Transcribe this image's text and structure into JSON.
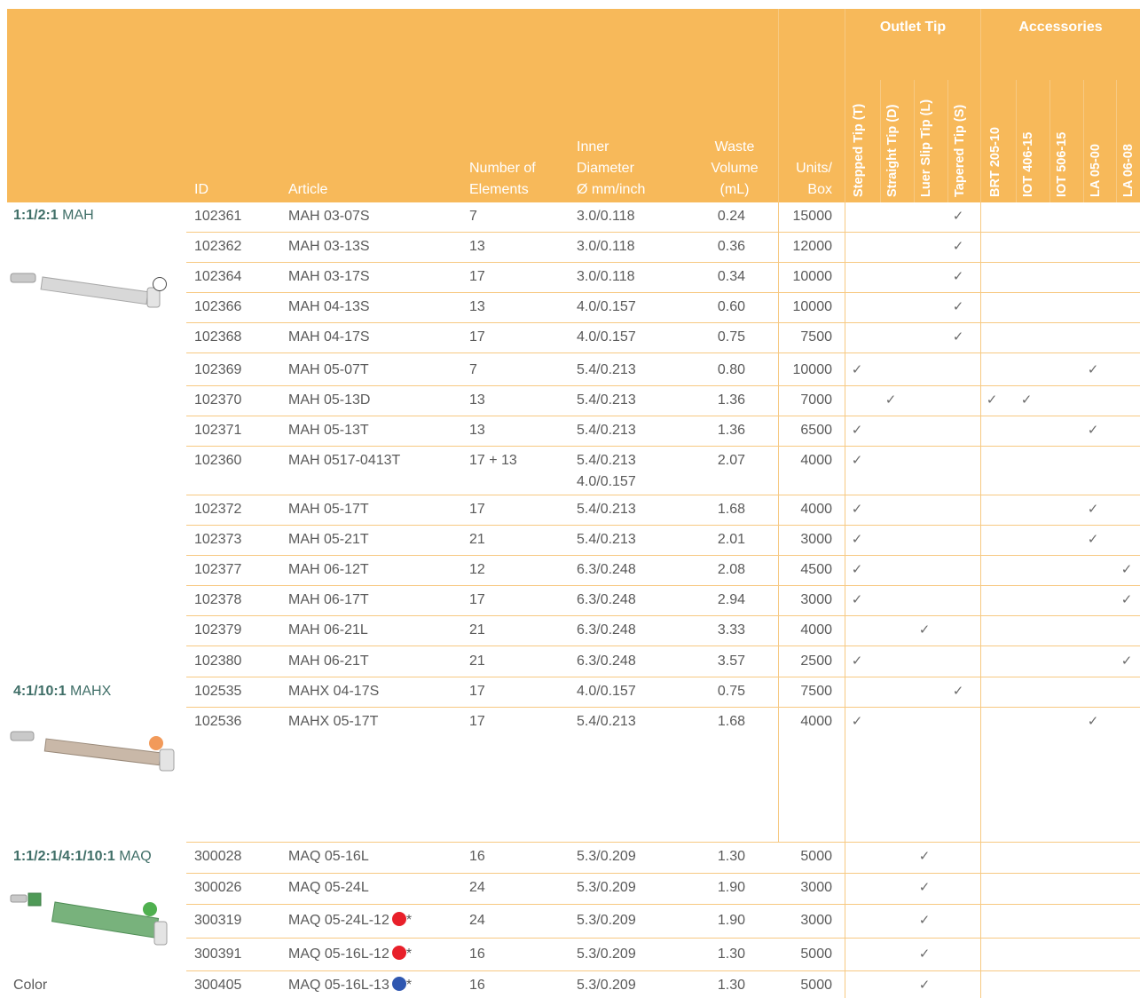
{
  "headers": {
    "id": "ID",
    "article": "Article",
    "elements": [
      "Number of",
      "Elements"
    ],
    "diameter": [
      "Inner",
      "Diameter",
      "Ø mm/inch"
    ],
    "waste": [
      "Waste",
      "Volume",
      "(mL)"
    ],
    "units": [
      "Units/",
      "Box"
    ],
    "outlet_group": "Outlet Tip",
    "outlet_tips": [
      "Stepped Tip (T)",
      "Straight Tip (D)",
      "Luer Slip Tip (L)",
      "Tapered Tip (S)"
    ],
    "accessories_group": "Accessories",
    "accessories": [
      "BRT 205-10",
      "IOT 406-15",
      "IOT 506-15",
      "LA 05-00",
      "LA 06-08"
    ]
  },
  "sections": [
    {
      "ratio": "1:1/2:1",
      "name": "MAH",
      "marker": "white"
    },
    {
      "ratio": "4:1/10:1",
      "name": "MAHX",
      "marker": "#f29a5a"
    },
    {
      "ratio": "1:1/2:1/4:1/10:1",
      "name": "MAQ",
      "marker": "#4fb04f",
      "footer": "Color"
    }
  ],
  "colors": {
    "header": "#f7b95a",
    "check": "#6b6b6b",
    "red": "#e8202a",
    "blue": "#2f57b0"
  },
  "rows": [
    {
      "id": "102361",
      "article": "MAH 03-07S",
      "elements": "7",
      "diameter": "3.0/0.118",
      "waste": "0.24",
      "units": "15000",
      "checks": [
        3
      ]
    },
    {
      "id": "102362",
      "article": "MAH 03-13S",
      "elements": "13",
      "diameter": "3.0/0.118",
      "waste": "0.36",
      "units": "12000",
      "checks": [
        3
      ]
    },
    {
      "id": "102364",
      "article": "MAH 03-17S",
      "elements": "17",
      "diameter": "3.0/0.118",
      "waste": "0.34",
      "units": "10000",
      "checks": [
        3
      ]
    },
    {
      "id": "102366",
      "article": "MAH 04-13S",
      "elements": "13",
      "diameter": "4.0/0.157",
      "waste": "0.60",
      "units": "10000",
      "checks": [
        3
      ]
    },
    {
      "id": "102368",
      "article": "MAH 04-17S",
      "elements": "17",
      "diameter": "4.0/0.157",
      "waste": "0.75",
      "units": "7500",
      "checks": [
        3
      ]
    },
    {
      "id": "102369",
      "article": "MAH 05-07T",
      "elements": "7",
      "diameter": "5.4/0.213",
      "waste": "0.80",
      "units": "10000",
      "checks": [
        0,
        7
      ]
    },
    {
      "id": "102370",
      "article": "MAH 05-13D",
      "elements": "13",
      "diameter": "5.4/0.213",
      "waste": "1.36",
      "units": "7000",
      "checks": [
        1,
        4,
        5
      ]
    },
    {
      "id": "102371",
      "article": "MAH 05-13T",
      "elements": "13",
      "diameter": "5.4/0.213",
      "waste": "1.36",
      "units": "6500",
      "checks": [
        0,
        7
      ]
    },
    {
      "id": "102360",
      "article": "MAH 0517-0413T",
      "elements": "17 + 13",
      "diameter": "5.4/0.213",
      "diameter2": "4.0/0.157",
      "waste": "2.07",
      "units": "4000",
      "checks": [
        0
      ]
    },
    {
      "id": "102372",
      "article": "MAH 05-17T",
      "elements": "17",
      "diameter": "5.4/0.213",
      "waste": "1.68",
      "units": "4000",
      "checks": [
        0,
        7
      ]
    },
    {
      "id": "102373",
      "article": "MAH 05-21T",
      "elements": "21",
      "diameter": "5.4/0.213",
      "waste": "2.01",
      "units": "3000",
      "checks": [
        0,
        7
      ]
    },
    {
      "id": "102377",
      "article": "MAH 06-12T",
      "elements": "12",
      "diameter": "6.3/0.248",
      "waste": "2.08",
      "units": "4500",
      "checks": [
        0,
        8
      ]
    },
    {
      "id": "102378",
      "article": "MAH 06-17T",
      "elements": "17",
      "diameter": "6.3/0.248",
      "waste": "2.94",
      "units": "3000",
      "checks": [
        0,
        8
      ]
    },
    {
      "id": "102379",
      "article": "MAH 06-21L",
      "elements": "21",
      "diameter": "6.3/0.248",
      "waste": "3.33",
      "units": "4000",
      "checks": [
        2
      ]
    },
    {
      "id": "102380",
      "article": "MAH 06-21T",
      "elements": "21",
      "diameter": "6.3/0.248",
      "waste": "3.57",
      "units": "2500",
      "checks": [
        0,
        8
      ]
    },
    {
      "id": "102535",
      "article": "MAHX 04-17S",
      "elements": "17",
      "diameter": "4.0/0.157",
      "waste": "0.75",
      "units": "7500",
      "checks": [
        3
      ]
    },
    {
      "id": "102536",
      "article": "MAHX 05-17T",
      "elements": "17",
      "diameter": "5.4/0.213",
      "waste": "1.68",
      "units": "4000",
      "checks": [
        0,
        7
      ]
    },
    {
      "id": "300028",
      "article": "MAQ 05-16L",
      "elements": "16",
      "diameter": "5.3/0.209",
      "waste": "1.30",
      "units": "5000",
      "checks": [
        2
      ]
    },
    {
      "id": "300026",
      "article": "MAQ 05-24L",
      "elements": "24",
      "diameter": "5.3/0.209",
      "waste": "1.90",
      "units": "3000",
      "checks": [
        2
      ]
    },
    {
      "id": "300319",
      "article": "MAQ 05-24L-12",
      "dot": "#e8202a",
      "star": "*",
      "elements": "24",
      "diameter": "5.3/0.209",
      "waste": "1.90",
      "units": "3000",
      "checks": [
        2
      ]
    },
    {
      "id": "300391",
      "article": "MAQ 05-16L-12",
      "dot": "#e8202a",
      "star": "*",
      "elements": "16",
      "diameter": "5.3/0.209",
      "waste": "1.30",
      "units": "5000",
      "checks": [
        2
      ]
    },
    {
      "id": "300405",
      "article": "MAQ 05-16L-13",
      "dot": "#2f57b0",
      "star": "*",
      "elements": "16",
      "diameter": "5.3/0.209",
      "waste": "1.30",
      "units": "5000",
      "checks": [
        2
      ]
    }
  ]
}
